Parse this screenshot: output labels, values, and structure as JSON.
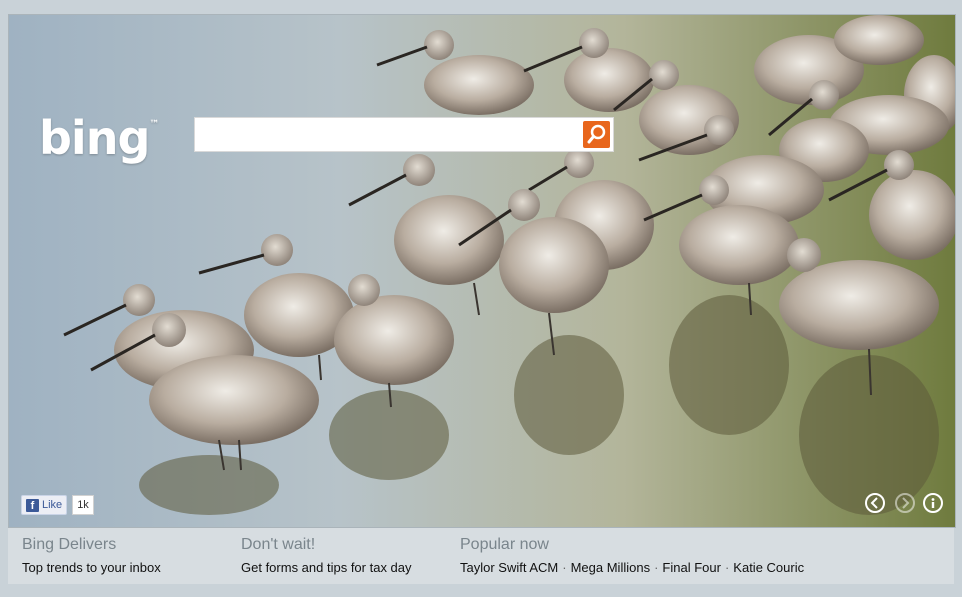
{
  "brand": {
    "logo_text": "bing",
    "trademark": "™"
  },
  "search": {
    "placeholder": "",
    "value": ""
  },
  "social": {
    "like_label": "Like",
    "like_count": "1k"
  },
  "carousel": {
    "prev_icon": "chevron-left-icon",
    "next_icon": "chevron-right-icon",
    "info_icon": "info-icon"
  },
  "footer": {
    "col1": {
      "heading": "Bing Delivers",
      "text": "Top trends to your inbox"
    },
    "col2": {
      "heading": "Don't wait!",
      "text": "Get forms and tips for tax day"
    },
    "col3": {
      "heading": "Popular now",
      "items": [
        "Taylor Swift ACM",
        "Mega Millions",
        "Final Four",
        "Katie Couric"
      ]
    }
  },
  "colors": {
    "accent": "#e8661c",
    "facebook": "#3b5998",
    "footer_bg": "#d7dde1"
  }
}
